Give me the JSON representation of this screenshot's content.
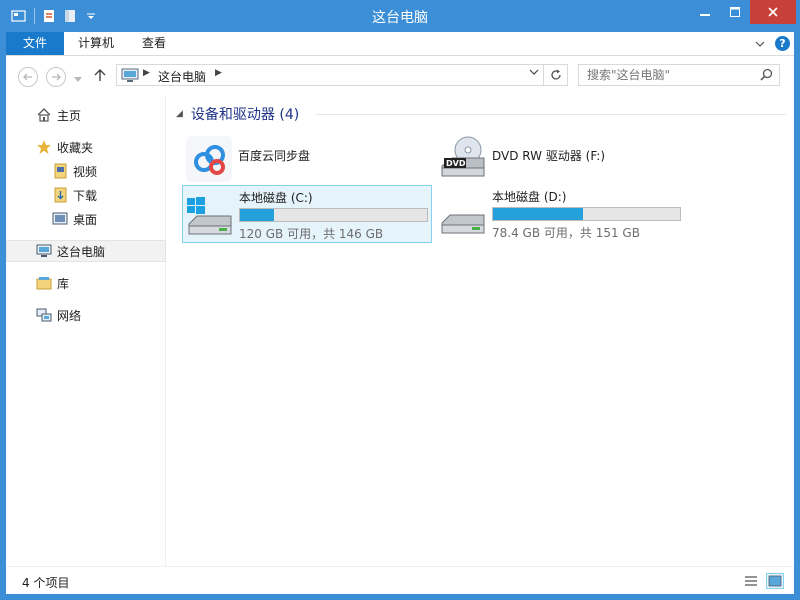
{
  "window": {
    "title": "这台电脑"
  },
  "ribbon": {
    "tabs": [
      "文件",
      "计算机",
      "查看"
    ]
  },
  "address": {
    "location": "这台电脑",
    "search_placeholder": "搜索\"这台电脑\""
  },
  "sidebar": {
    "home": "主页",
    "favorites": "收藏夹",
    "videos": "视频",
    "downloads": "下载",
    "desktop": "桌面",
    "this_pc": "这台电脑",
    "libraries": "库",
    "network": "网络"
  },
  "content": {
    "group_title": "设备和驱动器 (4)",
    "devices": [
      {
        "name": "百度云同步盘",
        "icon": "baidu-cloud-icon"
      },
      {
        "name": "DVD RW 驱动器 (F:)",
        "icon": "dvd-drive-icon"
      },
      {
        "name": "本地磁盘 (C:)",
        "icon": "windows-drive-icon",
        "usage_text": "120 GB 可用，共 146 GB",
        "used_fraction": 0.18
      },
      {
        "name": "本地磁盘 (D:)",
        "icon": "hard-drive-icon",
        "usage_text": "78.4 GB 可用，共 151 GB",
        "used_fraction": 0.48
      }
    ]
  },
  "status": {
    "item_count": "4 个项目"
  },
  "colors": {
    "accent": "#1979ca",
    "titlebar": "#3c8fd6",
    "close": "#c7413a",
    "progress": "#26a0da",
    "selection": "#e5f3fb"
  }
}
